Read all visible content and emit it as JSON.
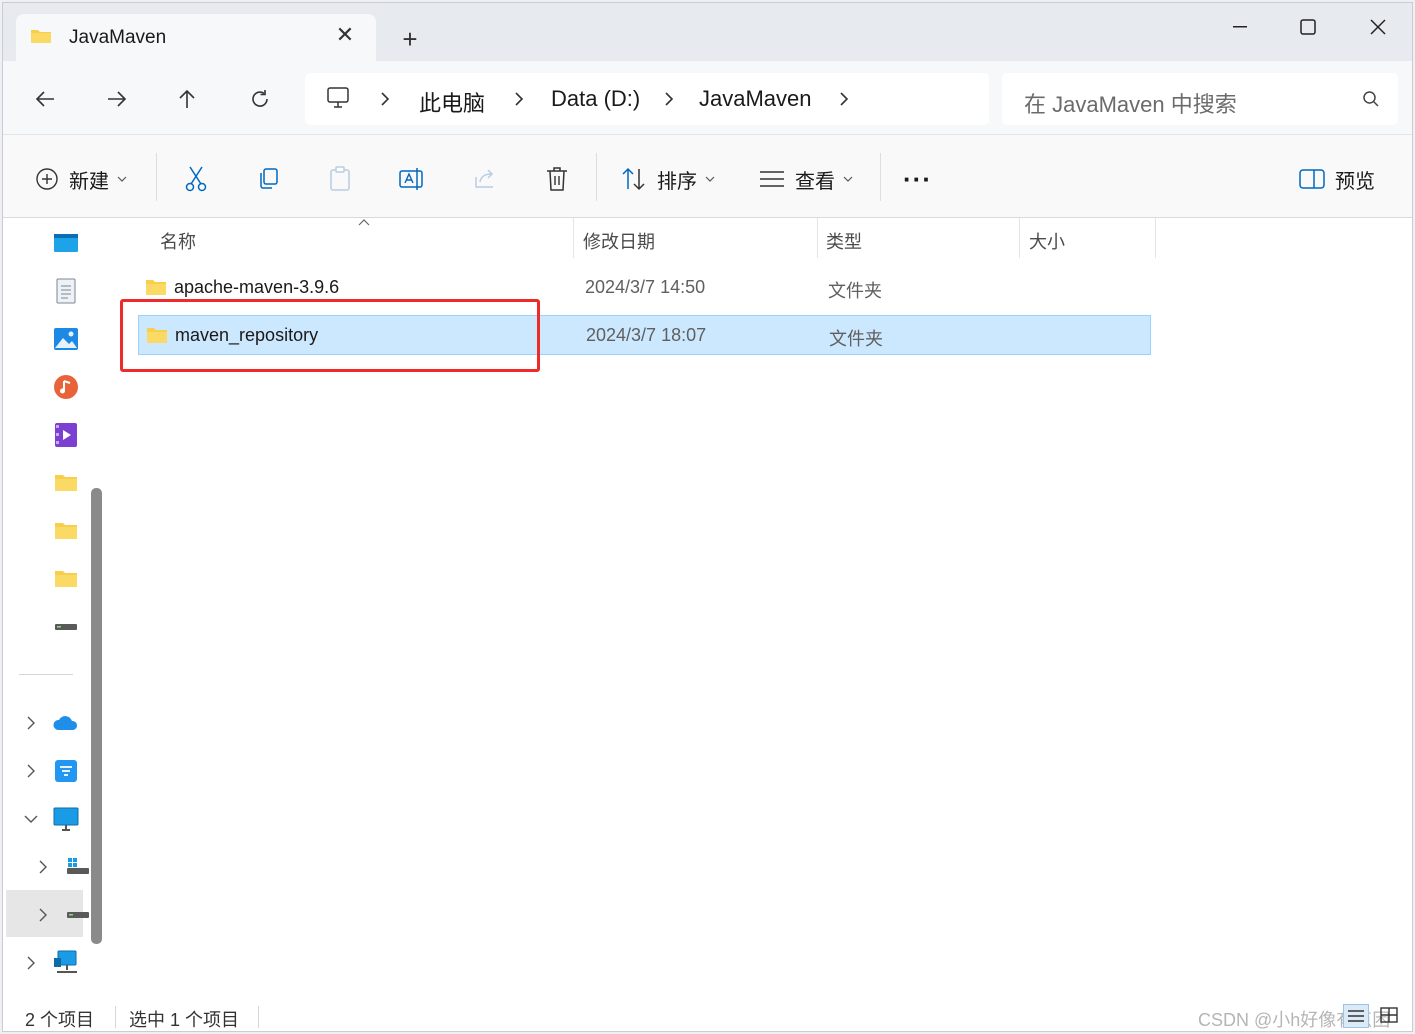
{
  "tab": {
    "title": "JavaMaven",
    "close_glyph": "✕",
    "new_tab_glyph": "+"
  },
  "window_controls": [
    "minimize-icon",
    "maximize-icon",
    "close-icon"
  ],
  "breadcrumb": [
    "此电脑",
    "Data (D:)",
    "JavaMaven"
  ],
  "search": {
    "placeholder": "在 JavaMaven 中搜索"
  },
  "toolbar": {
    "new_label": "新建",
    "sort_label": "排序",
    "view_label": "查看",
    "more_glyph": "···",
    "preview_label": "预览"
  },
  "columns": [
    "名称",
    "修改日期",
    "类型",
    "大小"
  ],
  "files": [
    {
      "name": "apache-maven-3.9.6",
      "date": "2024/3/7 14:50",
      "type": "文件夹",
      "size": ""
    },
    {
      "name": "maven_repository",
      "date": "2024/3/7 18:07",
      "type": "文件夹",
      "size": "",
      "selected": true
    }
  ],
  "status": {
    "item_count": "2 个项目",
    "selection": "选中 1 个项目"
  },
  "watermark": "CSDN @小h好像有点困",
  "colors": {
    "accent": "#0067c0",
    "selection_bg": "#cce8ff",
    "annotation_red": "#ee2a2a",
    "folder": "#f8cf4a"
  }
}
